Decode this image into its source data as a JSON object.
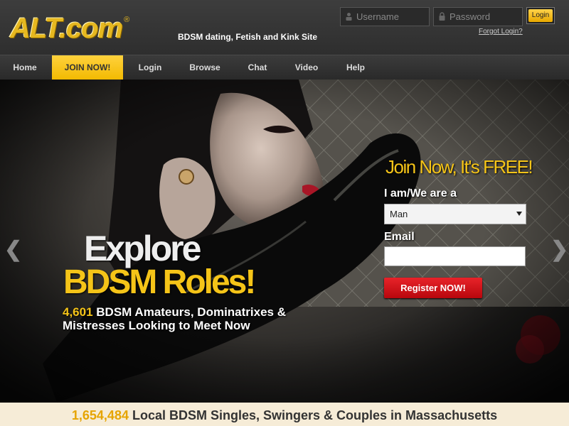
{
  "header": {
    "logo_text": "ALT.com",
    "logo_reg": "®",
    "tagline": "BDSM dating, Fetish and Kink Site",
    "username_placeholder": "Username",
    "password_placeholder": "Password",
    "login_label": "Login",
    "forgot_label": "Forgot Login?"
  },
  "nav": {
    "items": [
      {
        "label": "Home"
      },
      {
        "label": "JOIN NOW!"
      },
      {
        "label": "Login"
      },
      {
        "label": "Browse"
      },
      {
        "label": "Chat"
      },
      {
        "label": "Video"
      },
      {
        "label": "Help"
      }
    ],
    "active_index": 1
  },
  "hero": {
    "headline_1": "Explore",
    "headline_2": "BDSM Roles!",
    "count": "4,601",
    "subtext": "BDSM Amateurs, Dominatrixes & Mistresses Looking to Meet Now",
    "arrow_left": "❮",
    "arrow_right": "❯"
  },
  "signup": {
    "title": "Join Now, It's FREE!",
    "iam_label": "I am/We are a",
    "iam_value": "Man",
    "email_label": "Email",
    "email_value": "",
    "register_label": "Register NOW!"
  },
  "footer": {
    "count": "1,654,484",
    "text": "Local BDSM Singles, Swingers & Couples in Massachusetts"
  },
  "colors": {
    "accent_gold": "#f5c418",
    "register_red": "#d8141b",
    "header_bg": "#3a3a3a",
    "footer_bg": "#f6ecd7"
  }
}
